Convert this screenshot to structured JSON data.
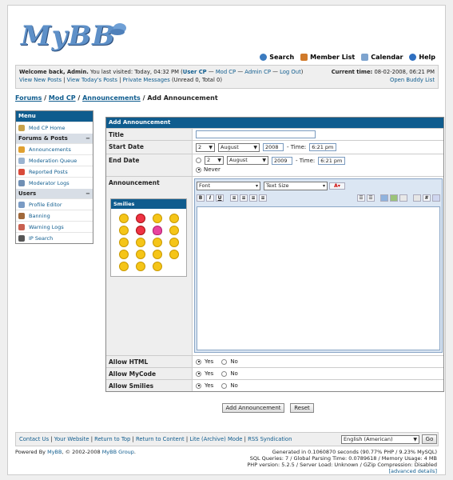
{
  "logo": {
    "text": "MyBB"
  },
  "toplinks": [
    {
      "label": "Search",
      "icon": "search-icon"
    },
    {
      "label": "Member List",
      "icon": "members-icon"
    },
    {
      "label": "Calendar",
      "icon": "calendar-icon"
    },
    {
      "label": "Help",
      "icon": "help-icon"
    }
  ],
  "welcome": {
    "greeting": "Welcome back, Admin.",
    "last_visited": "You last visited: Today, 04:32 PM",
    "open_paren": "(",
    "user_cp": "User CP",
    "sep1": "—",
    "mod_cp": "Mod CP",
    "sep2": "—",
    "admin_cp": "Admin CP",
    "sep3": "—",
    "logout": "Log Out",
    "close_paren": ")",
    "view_new": "View New Posts",
    "view_today": "View Today's Posts",
    "pm": "Private Messages",
    "pm_counts": "(Unread 0, Total 0)",
    "current_time_label": "Current time:",
    "current_time": "08-02-2008, 06:21 PM",
    "buddy": "Open Buddy List"
  },
  "breadcrumb": {
    "forums": "Forums",
    "modcp": "Mod CP",
    "announcements": "Announcements",
    "current": "Add Announcement",
    "sep": "/"
  },
  "menu": {
    "title": "Menu",
    "home": "Mod CP Home",
    "cat1": "Forums & Posts",
    "cat1_items": [
      "Announcements",
      "Moderation Queue",
      "Reported Posts",
      "Moderator Logs"
    ],
    "cat2": "Users",
    "cat2_items": [
      "Profile Editor",
      "Banning",
      "Warning Logs",
      "IP Search"
    ],
    "collapse": "−"
  },
  "form": {
    "title": "Add Announcement",
    "title_label": "Title",
    "title_value": "",
    "start_label": "Start Date",
    "start_day": "2",
    "start_month": "August",
    "start_year": "2008",
    "start_time_label": "- Time:",
    "start_time": "6:21 pm",
    "end_label": "End Date",
    "end_day": "2",
    "end_month": "August",
    "end_year": "2009",
    "end_time_label": "- Time:",
    "end_time": "6:21 pm",
    "never": "Never",
    "announcement_label": "Announcement",
    "font": "Font",
    "text_size": "Text Size",
    "color_btn": "A",
    "bold": "B",
    "italic": "I",
    "underline": "U",
    "smilies_title": "Smilies",
    "allow_html": "Allow HTML",
    "allow_mycode": "Allow MyCode",
    "allow_smilies": "Allow Smilies",
    "yes": "Yes",
    "no": "No",
    "submit": "Add Announcement",
    "reset": "Reset"
  },
  "footer": {
    "links": [
      "Contact Us",
      "Your Website",
      "Return to Top",
      "Return to Content",
      "Lite (Archive) Mode",
      "RSS Syndication"
    ],
    "sep": "|",
    "language": "English (American)",
    "go": "Go",
    "powered_prefix": "Powered By",
    "powered_link": "MyBB",
    "powered_mid": ", © 2002-2008",
    "powered_group": "MyBB Group",
    "powered_end": ".",
    "stats1": "Generated in 0.1060870 seconds (90.77% PHP / 9.23% MySQL)",
    "stats2": "SQL Queries: 7 / Global Parsing Time: 0.0789618 / Memory Usage: 4 MB",
    "stats3": "PHP version: 5.2.5 / Server Load: Unknown / GZip Compression: Disabled",
    "advanced": "[advanced details]"
  },
  "colors": {
    "accent": "#0f5c8e",
    "panel": "#efefef",
    "smile": "#f5c518"
  }
}
